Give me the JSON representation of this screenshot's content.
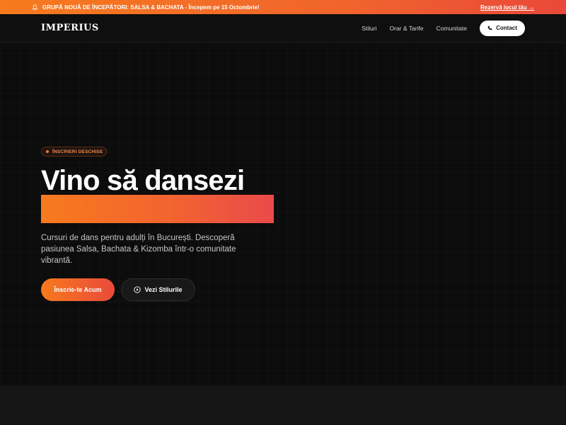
{
  "announcement": {
    "text": "GRUPĂ NOUĂ DE ÎNCEPĂTORI: SALSA & BACHATA - Începem pe 15 Octombrie!",
    "cta": "Rezervă locul tău →",
    "icon": "bell-icon"
  },
  "nav": {
    "logo": "IMPERIUS",
    "links": [
      "Stiluri",
      "Orar & Tarife",
      "Comunitate"
    ],
    "contact": {
      "label": "Contact",
      "icon": "phone-icon"
    }
  },
  "hero": {
    "badge": "ÎNSCRIERI DESCHISE",
    "headline": "Vino să dansezi",
    "description": "Cursuri de dans pentru adulți în București. Descoperă pasiunea Salsa, Bachata & Kizomba într-o comunitate vibrantă.",
    "primary_button": "Înscrie-te Acum",
    "secondary_button": {
      "label": "Vezi Stilurile",
      "icon": "play-circle-icon"
    }
  },
  "colors": {
    "accent_start": "#f77a1e",
    "accent_end": "#ea4a3a",
    "background": "#0d0d0d"
  }
}
